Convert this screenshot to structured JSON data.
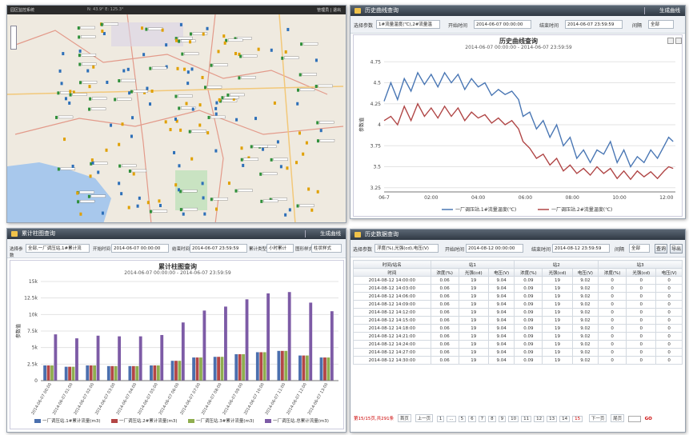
{
  "map_panel": {
    "logo": "园区监控系统",
    "coords": "N: 43.9°  E: 125.3°",
    "account": "管理员 | 退出"
  },
  "history_curve": {
    "title": "历史曲线查询",
    "gen_btn": "生成曲线",
    "param_label": "选择参数",
    "param_value": "1#流量温度(℃),2#流量温",
    "start_label": "开始时间",
    "start_value": "2014-06-07 00:00:00",
    "end_label": "结束时间",
    "end_value": "2014-06-07 23:59:59",
    "interval_label": "间隔",
    "interval_value": "全部"
  },
  "bar_panel": {
    "title": "累计柱图查询",
    "gen_btn": "生成曲线",
    "param_label": "选择参数",
    "param_value": "全部,一厂调压站,1#累计流",
    "start_label": "开始时间",
    "start_value": "2014-06-07 00:00:00",
    "end_label": "结束时间",
    "end_value": "2014-06-07 23:59:59",
    "type_label": "累计类型",
    "type_value": "小时累计",
    "style_label": "图形样式",
    "style_value": "柱状样式"
  },
  "table_panel": {
    "title": "历史数据查询",
    "param_label": "选择参数",
    "param_value": "浮度(%),光强(cd),电压(V)",
    "start_label": "开始时间",
    "start_value": "2014-08-12 00:00:00",
    "end_label": "结束时间",
    "end_value": "2014-08-12 23:59:59",
    "interval_label": "间隔",
    "interval_value": "全部",
    "query_btn": "查询",
    "export_btn": "导出",
    "header_station": "时间/站名",
    "header_time": "时间",
    "stations": [
      "站1",
      "站2",
      "站3"
    ],
    "cols": [
      "浓度(%)",
      "光强(cd)",
      "电压(V)",
      "浓度(%)",
      "光强(cd)",
      "电压(V)",
      "浓度(%)",
      "光强(cd)",
      "电压(V)"
    ],
    "rows": [
      [
        "2014-08-12 14:00:00",
        "0.06",
        "19",
        "9.04",
        "0.09",
        "19",
        "9.02",
        "0",
        "0",
        "0"
      ],
      [
        "2014-08-12 14:03:00",
        "0.06",
        "19",
        "9.04",
        "0.09",
        "19",
        "9.02",
        "0",
        "0",
        "0"
      ],
      [
        "2014-08-12 14:06:00",
        "0.06",
        "19",
        "9.04",
        "0.09",
        "19",
        "9.02",
        "0",
        "0",
        "0"
      ],
      [
        "2014-08-12 14:09:00",
        "0.06",
        "19",
        "9.04",
        "0.09",
        "19",
        "9.02",
        "0",
        "0",
        "0"
      ],
      [
        "2014-08-12 14:12:00",
        "0.06",
        "19",
        "9.04",
        "0.09",
        "19",
        "9.02",
        "0",
        "0",
        "0"
      ],
      [
        "2014-08-12 14:15:00",
        "0.06",
        "19",
        "9.04",
        "0.09",
        "19",
        "9.02",
        "0",
        "0",
        "0"
      ],
      [
        "2014-08-12 14:18:00",
        "0.06",
        "19",
        "9.04",
        "0.09",
        "19",
        "9.02",
        "0",
        "0",
        "0"
      ],
      [
        "2014-08-12 14:21:00",
        "0.06",
        "19",
        "9.04",
        "0.09",
        "19",
        "9.02",
        "0",
        "0",
        "0"
      ],
      [
        "2014-08-12 14:24:00",
        "0.06",
        "19",
        "9.04",
        "0.09",
        "19",
        "9.02",
        "0",
        "0",
        "0"
      ],
      [
        "2014-08-12 14:27:00",
        "0.06",
        "19",
        "9.04",
        "0.09",
        "19",
        "9.02",
        "0",
        "0",
        "0"
      ],
      [
        "2014-08-12 14:30:00",
        "0.06",
        "19",
        "9.04",
        "0.09",
        "19",
        "9.02",
        "0",
        "0",
        "0"
      ]
    ],
    "pager": {
      "summary": "第15/15页,共291条",
      "first": "首页",
      "prev": "上一页",
      "pages": [
        "1",
        "...",
        "5",
        "6",
        "7",
        "8",
        "9",
        "10",
        "11",
        "12",
        "13",
        "14",
        "15"
      ],
      "next": "下一页",
      "last": "尾页",
      "go": "GO"
    }
  },
  "chart_data": [
    {
      "type": "line",
      "title": "历史曲线查询",
      "subtitle": "2014-06-07 00:00:00 - 2014-06-07 23:59:59",
      "ylabel": "参数值",
      "ylim": [
        3.2,
        4.8
      ],
      "yticks": [
        "3.25",
        "3.5",
        "3.75",
        "4",
        "4.25",
        "4.5",
        "4.75"
      ],
      "xticks": [
        "06-7",
        "02:00",
        "04:00",
        "06:00",
        "08:00",
        "10:00",
        "12:00"
      ],
      "xlim": [
        0,
        13
      ],
      "series": [
        {
          "name": "一厂调压站.1#流量温度(℃)",
          "color": "#4a77b4",
          "points": [
            [
              0,
              4.28
            ],
            [
              0.3,
              4.5
            ],
            [
              0.6,
              4.3
            ],
            [
              0.9,
              4.55
            ],
            [
              1.2,
              4.4
            ],
            [
              1.5,
              4.62
            ],
            [
              1.8,
              4.48
            ],
            [
              2.1,
              4.6
            ],
            [
              2.4,
              4.45
            ],
            [
              2.7,
              4.62
            ],
            [
              3,
              4.5
            ],
            [
              3.3,
              4.6
            ],
            [
              3.6,
              4.42
            ],
            [
              3.9,
              4.55
            ],
            [
              4.2,
              4.45
            ],
            [
              4.5,
              4.5
            ],
            [
              4.8,
              4.35
            ],
            [
              5.1,
              4.42
            ],
            [
              5.4,
              4.36
            ],
            [
              5.7,
              4.4
            ],
            [
              6,
              4.3
            ],
            [
              6.2,
              4.1
            ],
            [
              6.5,
              4.15
            ],
            [
              6.8,
              3.95
            ],
            [
              7.1,
              4.05
            ],
            [
              7.4,
              3.85
            ],
            [
              7.7,
              4.0
            ],
            [
              8,
              3.75
            ],
            [
              8.3,
              3.85
            ],
            [
              8.6,
              3.6
            ],
            [
              8.9,
              3.7
            ],
            [
              9.2,
              3.55
            ],
            [
              9.5,
              3.7
            ],
            [
              9.8,
              3.65
            ],
            [
              10.1,
              3.8
            ],
            [
              10.4,
              3.55
            ],
            [
              10.7,
              3.7
            ],
            [
              11,
              3.5
            ],
            [
              11.3,
              3.62
            ],
            [
              11.6,
              3.55
            ],
            [
              11.9,
              3.7
            ],
            [
              12.2,
              3.6
            ],
            [
              12.5,
              3.75
            ],
            [
              12.7,
              3.85
            ],
            [
              12.9,
              3.8
            ]
          ]
        },
        {
          "name": "一厂调压站.2#流量温度(℃)",
          "color": "#b04646",
          "points": [
            [
              0,
              4.05
            ],
            [
              0.3,
              4.1
            ],
            [
              0.6,
              4.0
            ],
            [
              0.9,
              4.22
            ],
            [
              1.2,
              4.05
            ],
            [
              1.5,
              4.25
            ],
            [
              1.8,
              4.1
            ],
            [
              2.1,
              4.2
            ],
            [
              2.4,
              4.08
            ],
            [
              2.7,
              4.22
            ],
            [
              3,
              4.1
            ],
            [
              3.3,
              4.2
            ],
            [
              3.6,
              4.05
            ],
            [
              3.9,
              4.15
            ],
            [
              4.2,
              4.08
            ],
            [
              4.5,
              4.12
            ],
            [
              4.8,
              4.02
            ],
            [
              5.1,
              4.08
            ],
            [
              5.4,
              4.0
            ],
            [
              5.7,
              4.05
            ],
            [
              6,
              3.95
            ],
            [
              6.2,
              3.8
            ],
            [
              6.5,
              3.72
            ],
            [
              6.8,
              3.6
            ],
            [
              7.1,
              3.65
            ],
            [
              7.4,
              3.52
            ],
            [
              7.7,
              3.6
            ],
            [
              8,
              3.45
            ],
            [
              8.3,
              3.52
            ],
            [
              8.6,
              3.42
            ],
            [
              8.9,
              3.48
            ],
            [
              9.2,
              3.4
            ],
            [
              9.5,
              3.5
            ],
            [
              9.8,
              3.42
            ],
            [
              10.1,
              3.48
            ],
            [
              10.4,
              3.36
            ],
            [
              10.7,
              3.45
            ],
            [
              11,
              3.35
            ],
            [
              11.3,
              3.45
            ],
            [
              11.6,
              3.38
            ],
            [
              11.9,
              3.44
            ],
            [
              12.2,
              3.36
            ],
            [
              12.5,
              3.45
            ],
            [
              12.7,
              3.5
            ],
            [
              12.9,
              3.48
            ]
          ]
        }
      ],
      "legend": "bottom"
    },
    {
      "type": "bar",
      "title": "累计柱图查询",
      "subtitle": "2014-06-07 00:00:00 - 2014-06-07 23:59:59",
      "ylabel": "参数值",
      "ylim": [
        0,
        15000
      ],
      "yticks": [
        "0",
        "2.5k",
        "5k",
        "7.5k",
        "10k",
        "12.5k",
        "15k"
      ],
      "categories": [
        "2014-06-07 00:00",
        "2014-06-07 01:00",
        "2014-06-07 02:00",
        "2014-06-07 03:00",
        "2014-06-07 04:00",
        "2014-06-07 05:00",
        "2014-06-07 06:00",
        "2014-06-07 07:00",
        "2014-06-07 08:00",
        "2014-06-07 09:00",
        "2014-06-07 10:00",
        "2014-06-07 11:00",
        "2014-06-07 12:00",
        "2014-06-07 13:00"
      ],
      "series": [
        {
          "name": "一厂调压站.1#累计流量(m3)",
          "color": "#4b6fae",
          "values": [
            2300,
            2100,
            2300,
            2200,
            2200,
            2300,
            3000,
            3500,
            3600,
            4000,
            4300,
            4500,
            3800,
            3500
          ]
        },
        {
          "name": "一厂调压站.2#累计流量(m3)",
          "color": "#b34646",
          "values": [
            2300,
            2100,
            2300,
            2200,
            2200,
            2300,
            3000,
            3500,
            3600,
            4000,
            4300,
            4500,
            3800,
            3500
          ]
        },
        {
          "name": "一厂调压站.3#累计流量(m3)",
          "color": "#8fae4f",
          "values": [
            2300,
            2100,
            2300,
            2200,
            2200,
            2300,
            3000,
            3500,
            3600,
            4000,
            4300,
            4500,
            3800,
            3500
          ]
        },
        {
          "name": "一厂调压站.总累计流量(m3)",
          "color": "#7d5ba6",
          "values": [
            7000,
            6400,
            6800,
            6700,
            6700,
            6900,
            8800,
            10600,
            11200,
            12300,
            13200,
            13400,
            11800,
            10500
          ]
        }
      ],
      "legend": "bottom"
    }
  ]
}
